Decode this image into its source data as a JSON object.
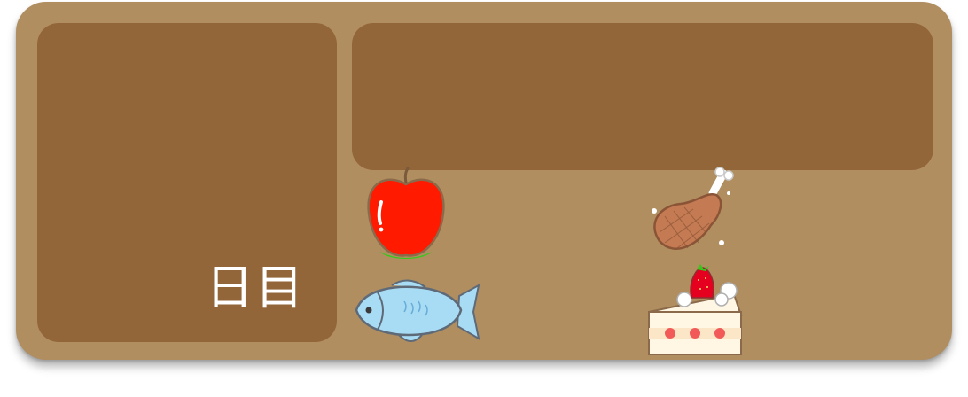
{
  "day_panel": {
    "label": "日目"
  },
  "message_panel": {
    "text": ""
  },
  "foods": [
    {
      "name": "apple",
      "icon": "apple-icon"
    },
    {
      "name": "chicken",
      "icon": "chicken-leg-icon"
    },
    {
      "name": "fish",
      "icon": "fish-icon"
    },
    {
      "name": "cake",
      "icon": "strawberry-cake-icon"
    }
  ],
  "colors": {
    "board": "#b08e60",
    "panel": "#936639",
    "label_text": "#ffffff"
  }
}
